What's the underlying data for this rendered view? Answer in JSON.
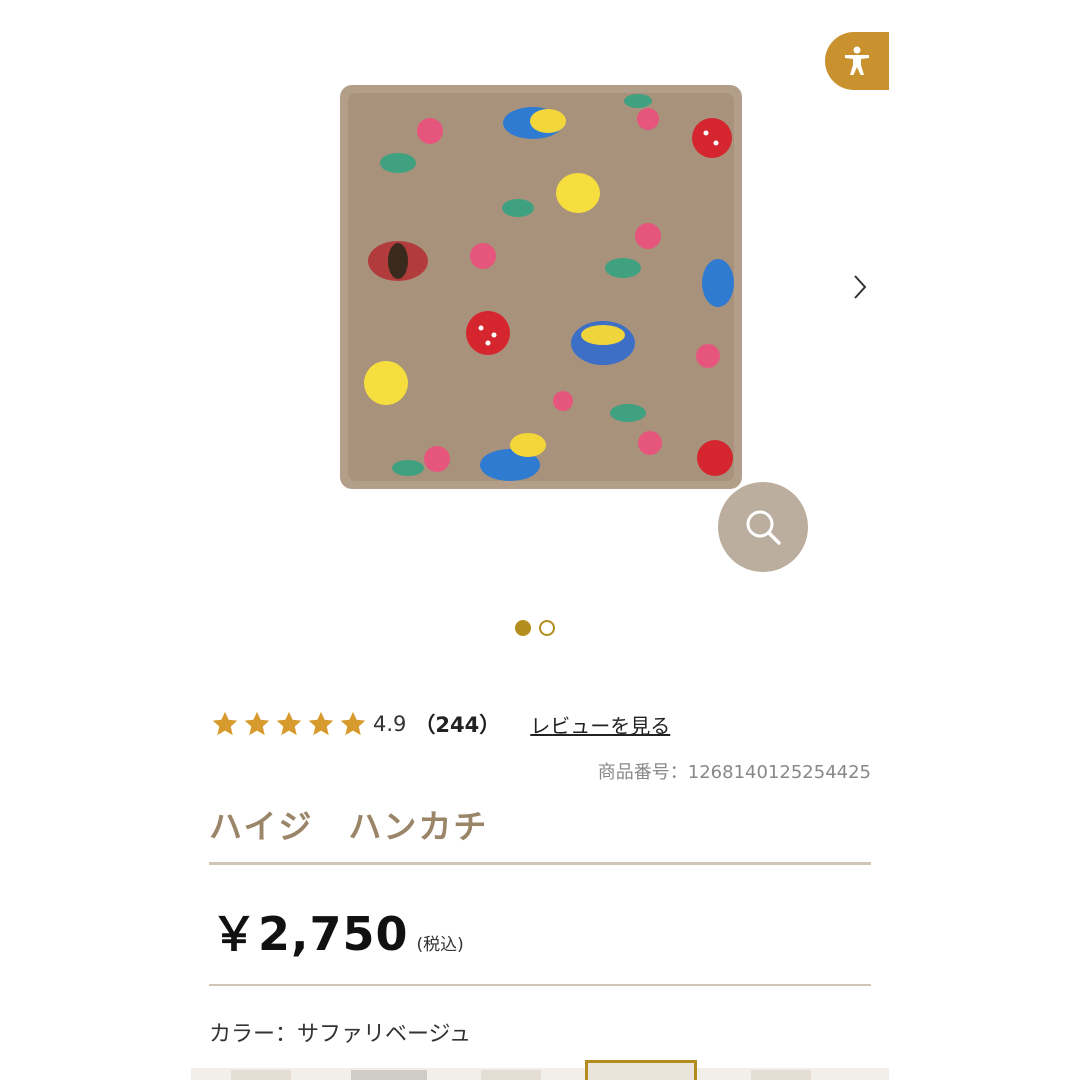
{
  "gallery": {
    "product_image_alt": "ハイジ ハンカチ",
    "slides_total": 2,
    "active_slide": 1
  },
  "icons": {
    "accessibility": "accessibility-icon",
    "next": "chevron-right-icon",
    "zoom": "search-icon",
    "star": "star-icon"
  },
  "rating": {
    "stars": 5,
    "value": "4.9",
    "count": "（244）",
    "review_link": "レビューを見る"
  },
  "product": {
    "item_number": "商品番号：1268140125254425",
    "title": "ハイジ　ハンカチ",
    "price": "￥2,750",
    "tax_note": "(税込)",
    "color_label": "カラー：サファリベージュ"
  },
  "colors": {
    "accent": "#b38e1f",
    "title": "#9b8568",
    "zoom_bg": "#bcae9e",
    "access_bg": "#c9922f"
  }
}
